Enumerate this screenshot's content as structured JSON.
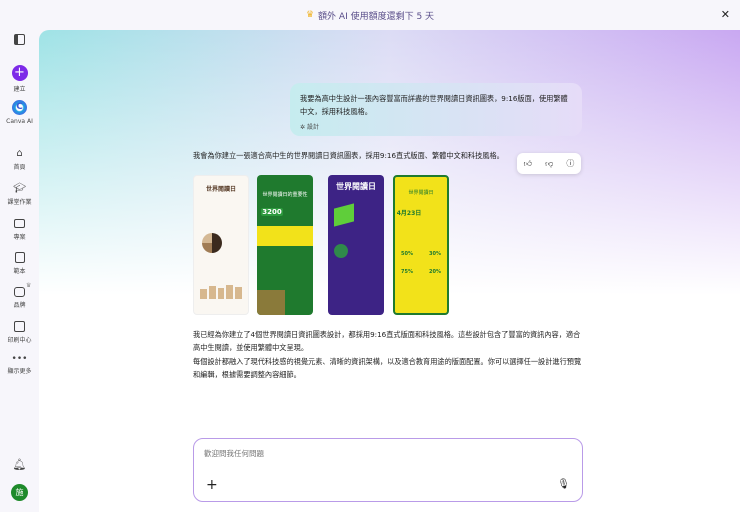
{
  "banner": {
    "icon": "crown-icon",
    "text": "額外 AI 使用額度還剩下 5 天",
    "close": "✕"
  },
  "sidebar": {
    "items": [
      {
        "label": "建立",
        "icon": "plus-icon"
      },
      {
        "label": "Canva AI",
        "icon": "canva-ai-icon"
      },
      {
        "label": "首頁",
        "icon": "home-icon"
      },
      {
        "label": "課堂作業",
        "icon": "graduation-cap-icon"
      },
      {
        "label": "專案",
        "icon": "folder-icon"
      },
      {
        "label": "範本",
        "icon": "template-icon"
      },
      {
        "label": "品牌",
        "icon": "brand-icon"
      },
      {
        "label": "印刷中心",
        "icon": "print-icon"
      },
      {
        "label": "顯示更多",
        "icon": "more-icon"
      }
    ],
    "avatar": "施"
  },
  "chat": {
    "user_message": "我要為高中生設計一張內容豐富而詳盡的世界閱讀日資訊圖表，9:16版面，使用繁體中文，採用科技風格。",
    "user_tag": "設計",
    "response_intro": "我會為你建立一張適合高中生的世界閱讀日資訊圖表，採用9:16直式版面、繁體中文和科技風格。",
    "designs": [
      {
        "title": "世界閱讀日"
      },
      {
        "title": "世界閱讀日的重要性",
        "stat": "3200"
      },
      {
        "title": "世界閱讀日"
      },
      {
        "title": "世界閱讀日",
        "date": "4月23日",
        "stats": [
          "50%",
          "30%",
          "75%",
          "20%"
        ]
      }
    ],
    "response_p1": "我已經為你建立了4個世界閱讀日資訊圖表設計，都採用9:16直式版面和科技風格。這些設計包含了豐富的資訊內容，適合高中生閱讀，並使用繁體中文呈現。",
    "response_p2": "每個設計都融入了現代科技感的視覺元素、清晰的資訊架構，以及適合教育用途的版面配置。你可以選擇任一設計進行預覽和編輯，根據需要調整內容細節。"
  },
  "composer": {
    "placeholder": "歡迎問我任何問題"
  }
}
